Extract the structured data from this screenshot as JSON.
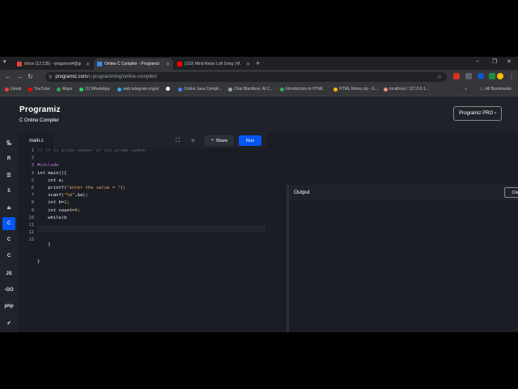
{
  "tabs": [
    {
      "label": "Inbox (12,135) - rjingaresd4@gmail...",
      "color": "#ea4335"
    },
    {
      "label": "Online C Compiler - Programiz",
      "color": "#4285f4"
    },
    {
      "label": "(110) Mind Relax Lofi Song | M...",
      "color": "#ff0000"
    }
  ],
  "window_controls": {
    "minimize": "–",
    "restore": "❐",
    "close": "✕"
  },
  "address_bar": {
    "host": "programiz.com",
    "path": "/c-programming/online-compiler/"
  },
  "bookmarks": [
    {
      "label": "Gmail",
      "color": "#ea4335"
    },
    {
      "label": "YouTube",
      "color": "#ff0000"
    },
    {
      "label": "Maps",
      "color": "#34a853"
    },
    {
      "label": "(1) WhatsApp",
      "color": "#25d366"
    },
    {
      "label": "web.telegram.org/a/",
      "color": "#2aabee"
    },
    {
      "label": "",
      "color": "#ffffff"
    },
    {
      "label": "Online Java Compil...",
      "color": "#4285f4"
    },
    {
      "label": "Chat Blackbox: AI C...",
      "color": "#9aa0a6"
    },
    {
      "label": "Introduction to HTML",
      "color": "#34a853"
    },
    {
      "label": "HTML Notes.zip - G...",
      "color": "#fbbc04"
    },
    {
      "label": "localhost / 127.0.0.1...",
      "color": "#f28b82"
    }
  ],
  "all_bookmarks": "All Bookmarks",
  "site": {
    "logo": "Programiz",
    "subtitle": "C Online Compiler",
    "pro_button": "Programiz PRO ›"
  },
  "languages": [
    "python",
    "r",
    "sql",
    "html",
    "java",
    "c",
    "c++",
    "c#",
    "js",
    "go",
    "php",
    "swift"
  ],
  "editor": {
    "file_tab": "main.c",
    "share_label": "Share",
    "run_label": "Run",
    "lines": [
      "1",
      "2",
      "3",
      "4",
      "5",
      "6",
      "7",
      "8",
      "9",
      "10",
      "11",
      "12",
      "13"
    ]
  },
  "output": {
    "label": "Output",
    "clear_label": "Clear"
  }
}
